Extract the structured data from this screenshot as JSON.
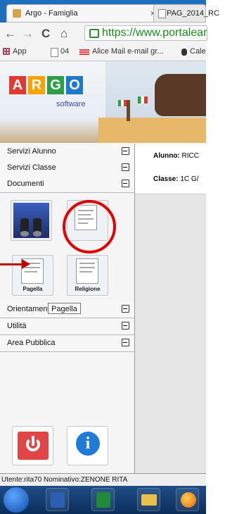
{
  "browser": {
    "active_tab_title": "Argo - Famiglia",
    "active_tab_close": "×",
    "inactive_tab_title": "PAG_2014_RC",
    "url": "https://www.portalear",
    "nav": {
      "back": "←",
      "forward": "→",
      "reload": "C",
      "home": "⌂"
    },
    "bookmarks": [
      "App",
      "04",
      "Alice Mail e-mail gr...",
      "Cale"
    ]
  },
  "header": {
    "logo_letters": [
      "A",
      "R",
      "G",
      "O"
    ],
    "logo_subtitle": "software",
    "logo_colors": [
      "#e03a34",
      "#f6a300",
      "#2e9e46",
      "#1f78c8"
    ]
  },
  "sidebar": {
    "menu": [
      {
        "label": "Servizi Alunno",
        "expanded": false
      },
      {
        "label": "Servizi Classe",
        "expanded": false
      },
      {
        "label": "Documenti",
        "expanded": true
      }
    ],
    "documents_icons": [
      {
        "name": "binoculars",
        "caption": ""
      },
      {
        "name": "document",
        "caption": ""
      },
      {
        "name": "pagella",
        "caption": "Pagella"
      },
      {
        "name": "religione",
        "caption": "Religione"
      }
    ],
    "menu_after": [
      {
        "label": "Orientamento",
        "expanded": false
      },
      {
        "label": "Utilità",
        "expanded": false
      },
      {
        "label": "Area Pubblica",
        "expanded": false
      }
    ],
    "tooltip": "Pagella"
  },
  "content": {
    "alunno_label": "Alunno:",
    "alunno_value": "RICC",
    "classe_label": "Classe:",
    "classe_value": "1C G/"
  },
  "status_bar": "Utente:rita70 Nominativo:ZENONE RITA",
  "annotation_color": "#e00000"
}
